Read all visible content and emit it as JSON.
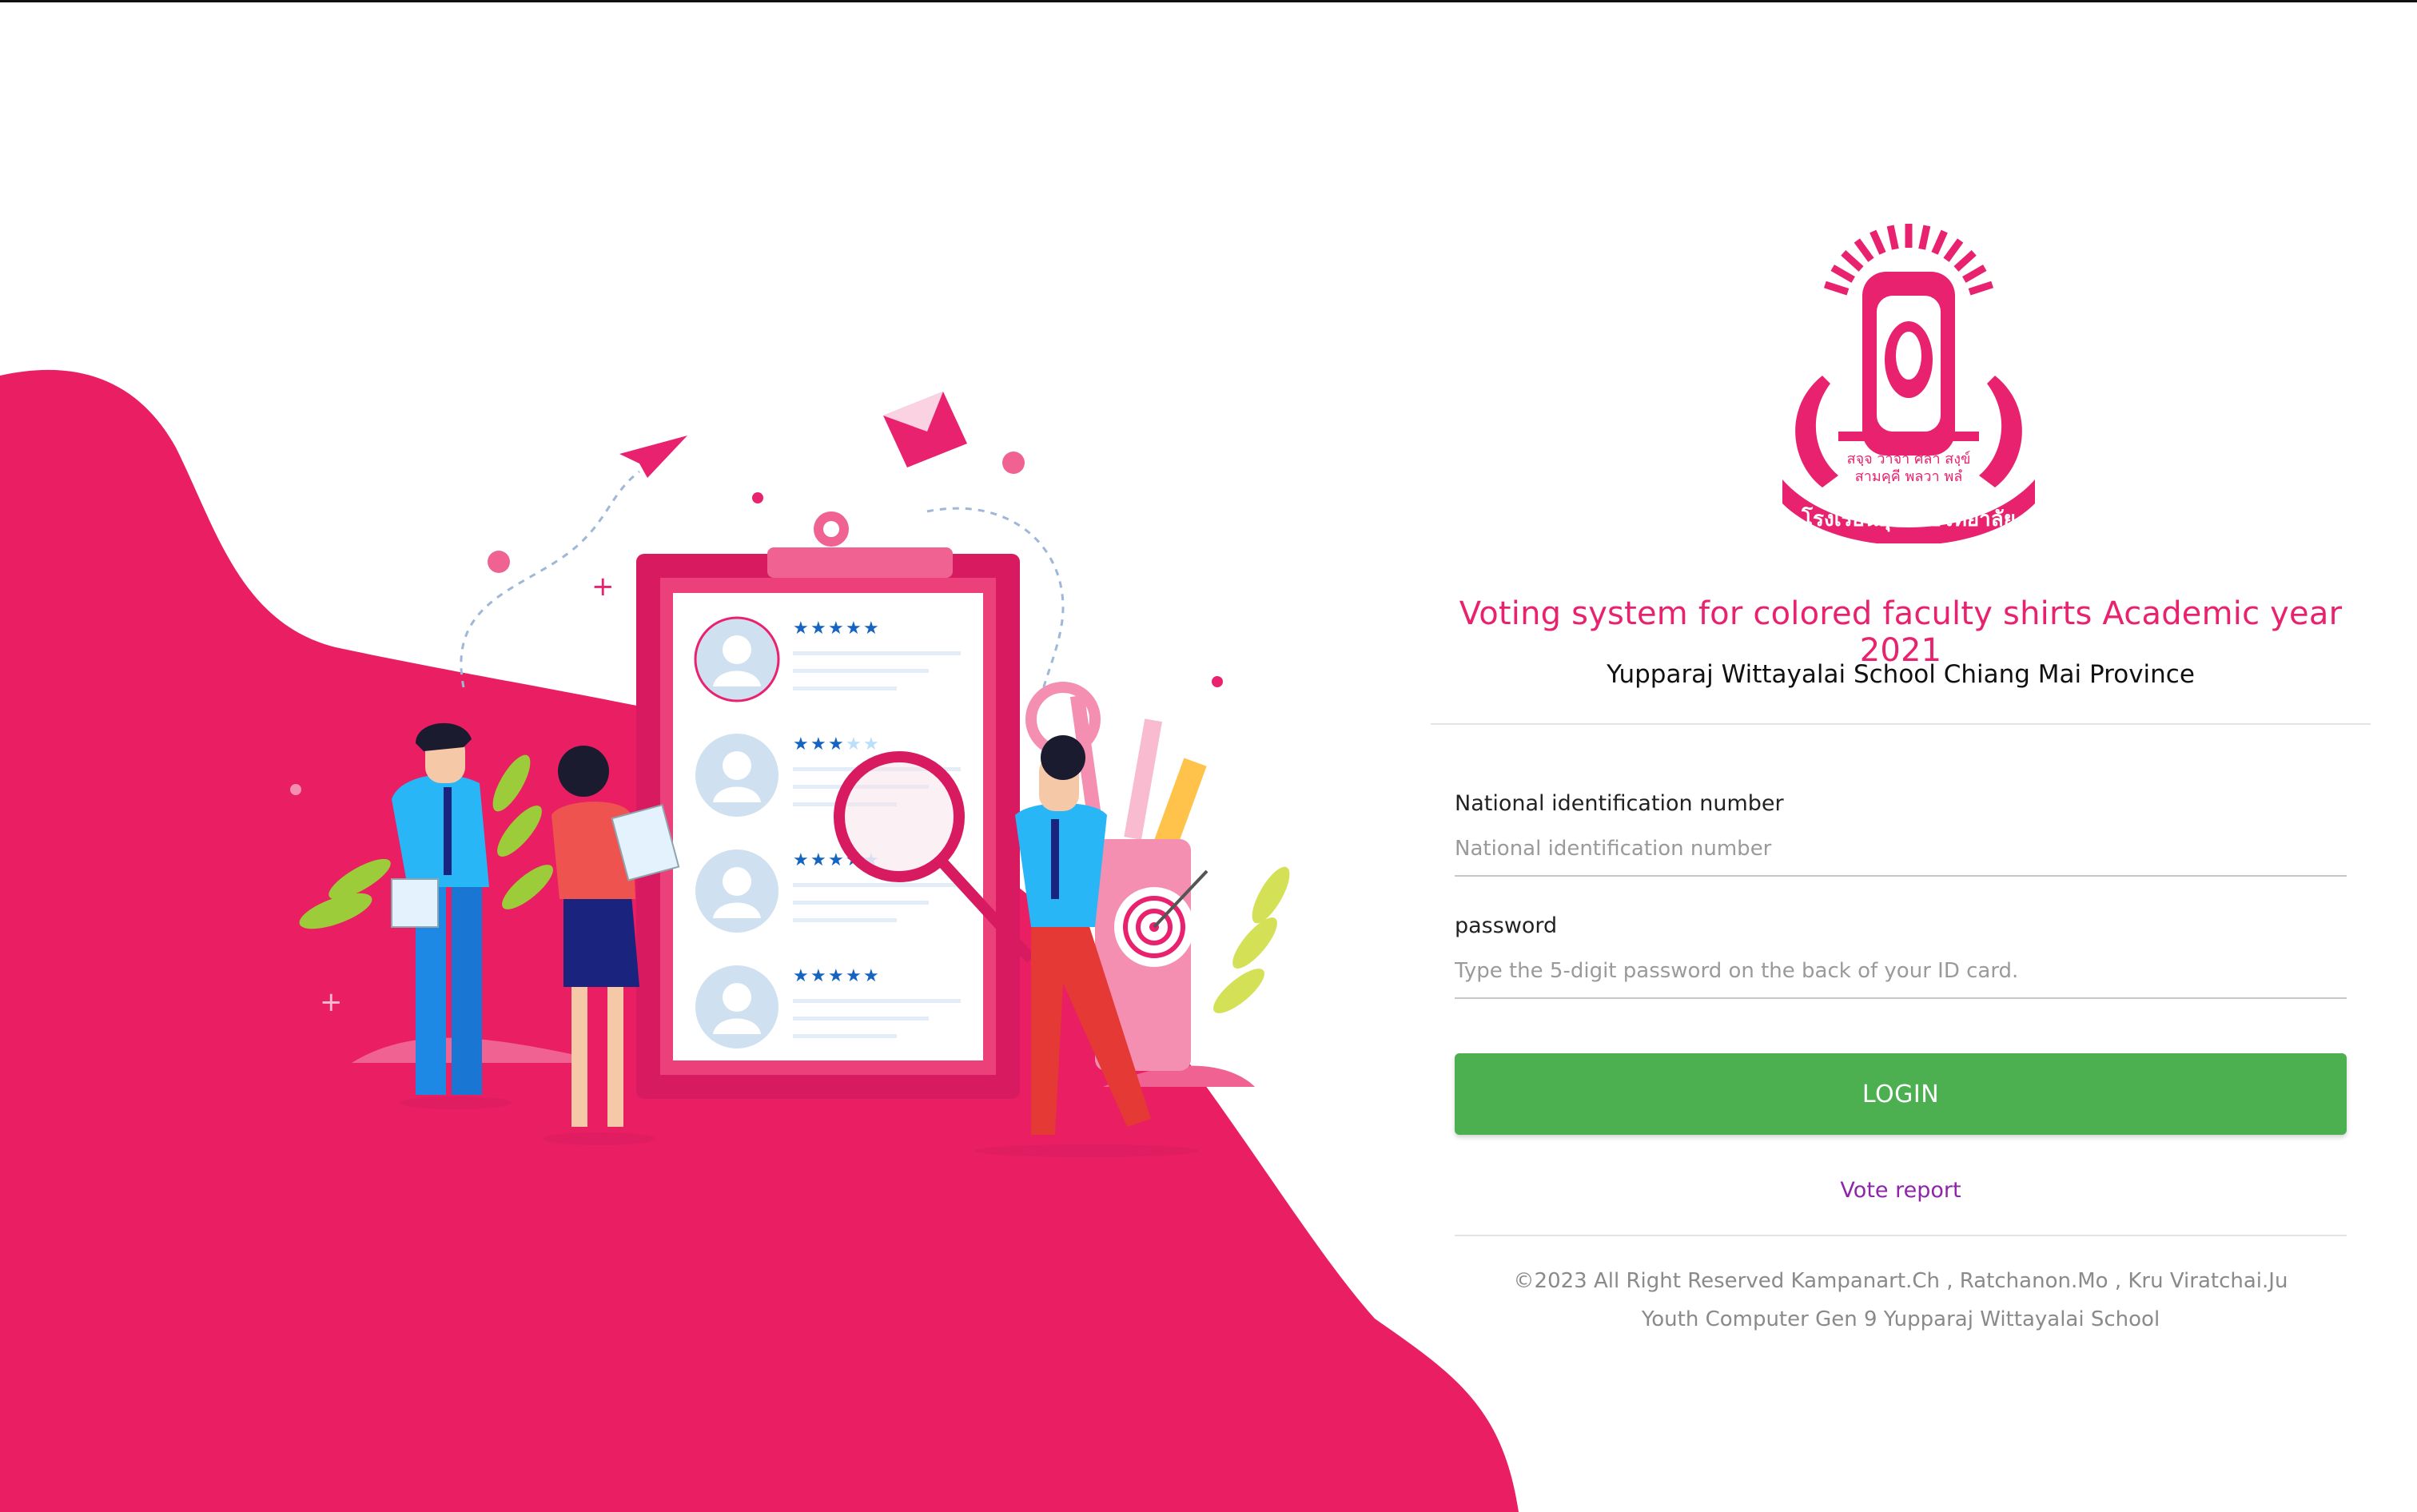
{
  "header": {
    "title": "Voting system for colored faculty shirts Academic year 2021",
    "subtitle": "Yupparaj Wittayalai School Chiang Mai Province"
  },
  "logo": {
    "motto_line1": "สจฺจ วาจา ศลา สงฺข์",
    "motto_line2": "สามคฺคี พลวา พลํ",
    "school_name": "โรงเรียนยุพราชวิทยาลัย",
    "color": "#e8226e"
  },
  "form": {
    "id_label": "National identification number",
    "id_placeholder": "National identification number",
    "password_label": "password",
    "password_placeholder": "Type the 5-digit password on the back of your ID card.",
    "login_label": "LOGIN",
    "vote_report_label": "Vote report"
  },
  "footer": {
    "line1": "©2023 All Right Reserved Kampanart.Ch , Ratchanon.Mo , Kru Viratchai.Ju",
    "line2": "Youth Computer Gen 9 Yupparaj Wittayalai School"
  },
  "colors": {
    "accent": "#e8226e",
    "login_button": "#4caf50",
    "link": "#8e24aa"
  },
  "illustration": {
    "theme": "voting-candidates-illustration",
    "ratings": [
      5,
      3,
      4,
      5
    ]
  }
}
